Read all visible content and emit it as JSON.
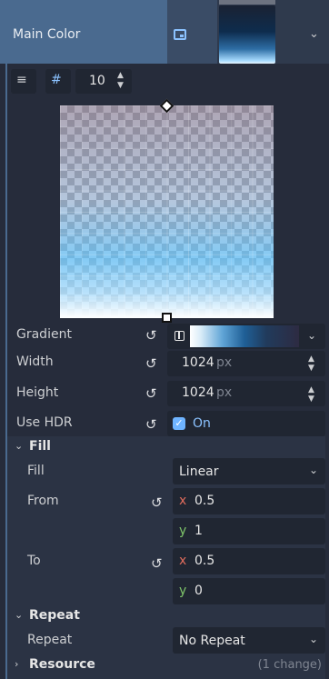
{
  "header": {
    "title": "Main Color",
    "resource_icon": "texture-icon",
    "dropdown_icon": "chevron-down-icon"
  },
  "toolbar": {
    "snap_value": "10",
    "align_icon": "align-icon",
    "grid_snap_icon": "grid-snap-icon"
  },
  "properties": {
    "gradient": {
      "label": "Gradient"
    },
    "width": {
      "label": "Width",
      "value": "1024",
      "unit": "px"
    },
    "height": {
      "label": "Height",
      "value": "1024",
      "unit": "px"
    },
    "use_hdr": {
      "label": "Use HDR",
      "value": "On",
      "checked": true
    }
  },
  "fill_section": {
    "title": "Fill",
    "fill": {
      "label": "Fill",
      "value": "Linear"
    },
    "from": {
      "label": "From",
      "x_label": "x",
      "x": "0.5",
      "y_label": "y",
      "y": "1"
    },
    "to": {
      "label": "To",
      "x_label": "x",
      "x": "0.5",
      "y_label": "y",
      "y": "0"
    }
  },
  "repeat_section": {
    "title": "Repeat",
    "repeat": {
      "label": "Repeat",
      "value": "No Repeat"
    }
  },
  "resource_section": {
    "title": "Resource",
    "changes": "(1 change)"
  },
  "colors": {
    "accent": "#4a6a8f",
    "checkbox": "#6fb4ff",
    "x_axis": "#e06c5c",
    "y_axis": "#7ec46a"
  }
}
